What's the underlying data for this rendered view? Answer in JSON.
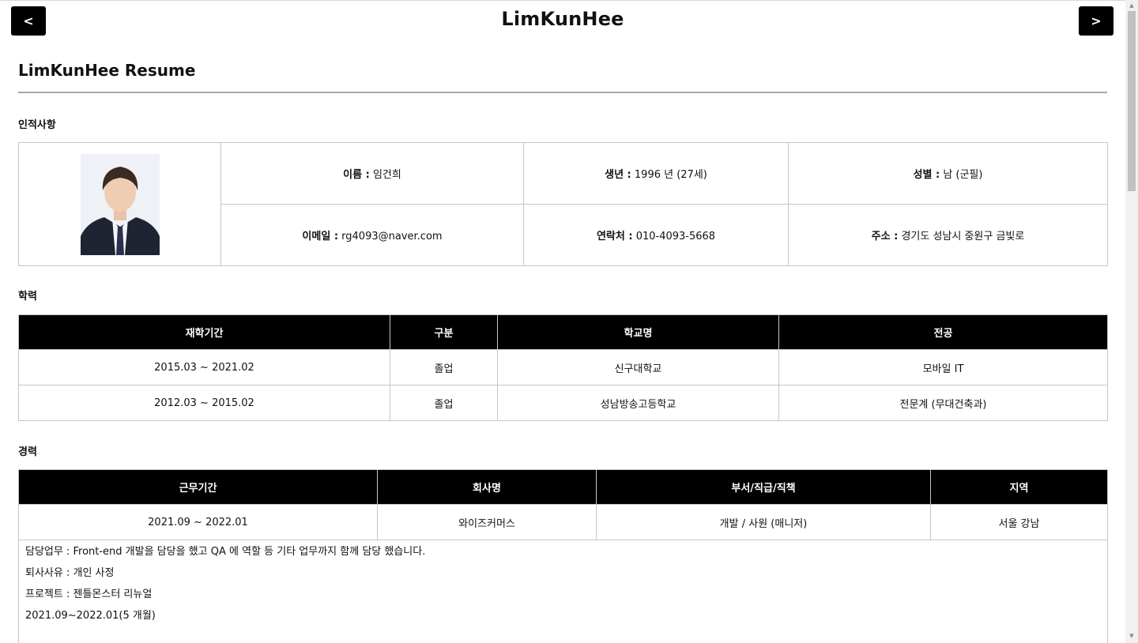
{
  "header": {
    "title": "LimKunHee",
    "prev_label": "<",
    "next_label": ">"
  },
  "resume": {
    "title": "LimKunHee Resume"
  },
  "profile": {
    "section_label": "인적사항",
    "name_label": "이름 :",
    "name_value": "임건희",
    "birth_label": "생년 :",
    "birth_value": "1996 년 (27세)",
    "gender_label": "성별 :",
    "gender_value": "남 (군필)",
    "email_label": "이메일 :",
    "email_value": "rg4093@naver.com",
    "phone_label": "연락처 :",
    "phone_value": "010-4093-5668",
    "address_label": "주소 :",
    "address_value": "경기도 성남시 중원구 금빛로"
  },
  "education": {
    "section_label": "학력",
    "headers": [
      "재학기간",
      "구분",
      "학교명",
      "전공"
    ],
    "rows": [
      [
        "2015.03 ~ 2021.02",
        "졸업",
        "신구대학교",
        "모바일 IT"
      ],
      [
        "2012.03 ~ 2015.02",
        "졸업",
        "성남방송고등학교",
        "전문계 (무대건축과)"
      ]
    ]
  },
  "career": {
    "section_label": "경력",
    "headers": [
      "근무기간",
      "회사명",
      "부서/직급/직책",
      "지역"
    ],
    "rows": [
      [
        "2021.09 ~ 2022.01",
        "와이즈커머스",
        "개발 / 사원 (매니저)",
        "서울 강남"
      ]
    ],
    "details": [
      "담당업무 : Front-end 개발을 담당을 했고 QA 에 역할 등 기타 업무까지 함께 담당 했습니다.",
      "퇴사사유 : 개인 사정",
      "프로젝트 : 젠틀몬스터 리뉴얼",
      "2021.09~2022.01(5 개월)"
    ]
  }
}
